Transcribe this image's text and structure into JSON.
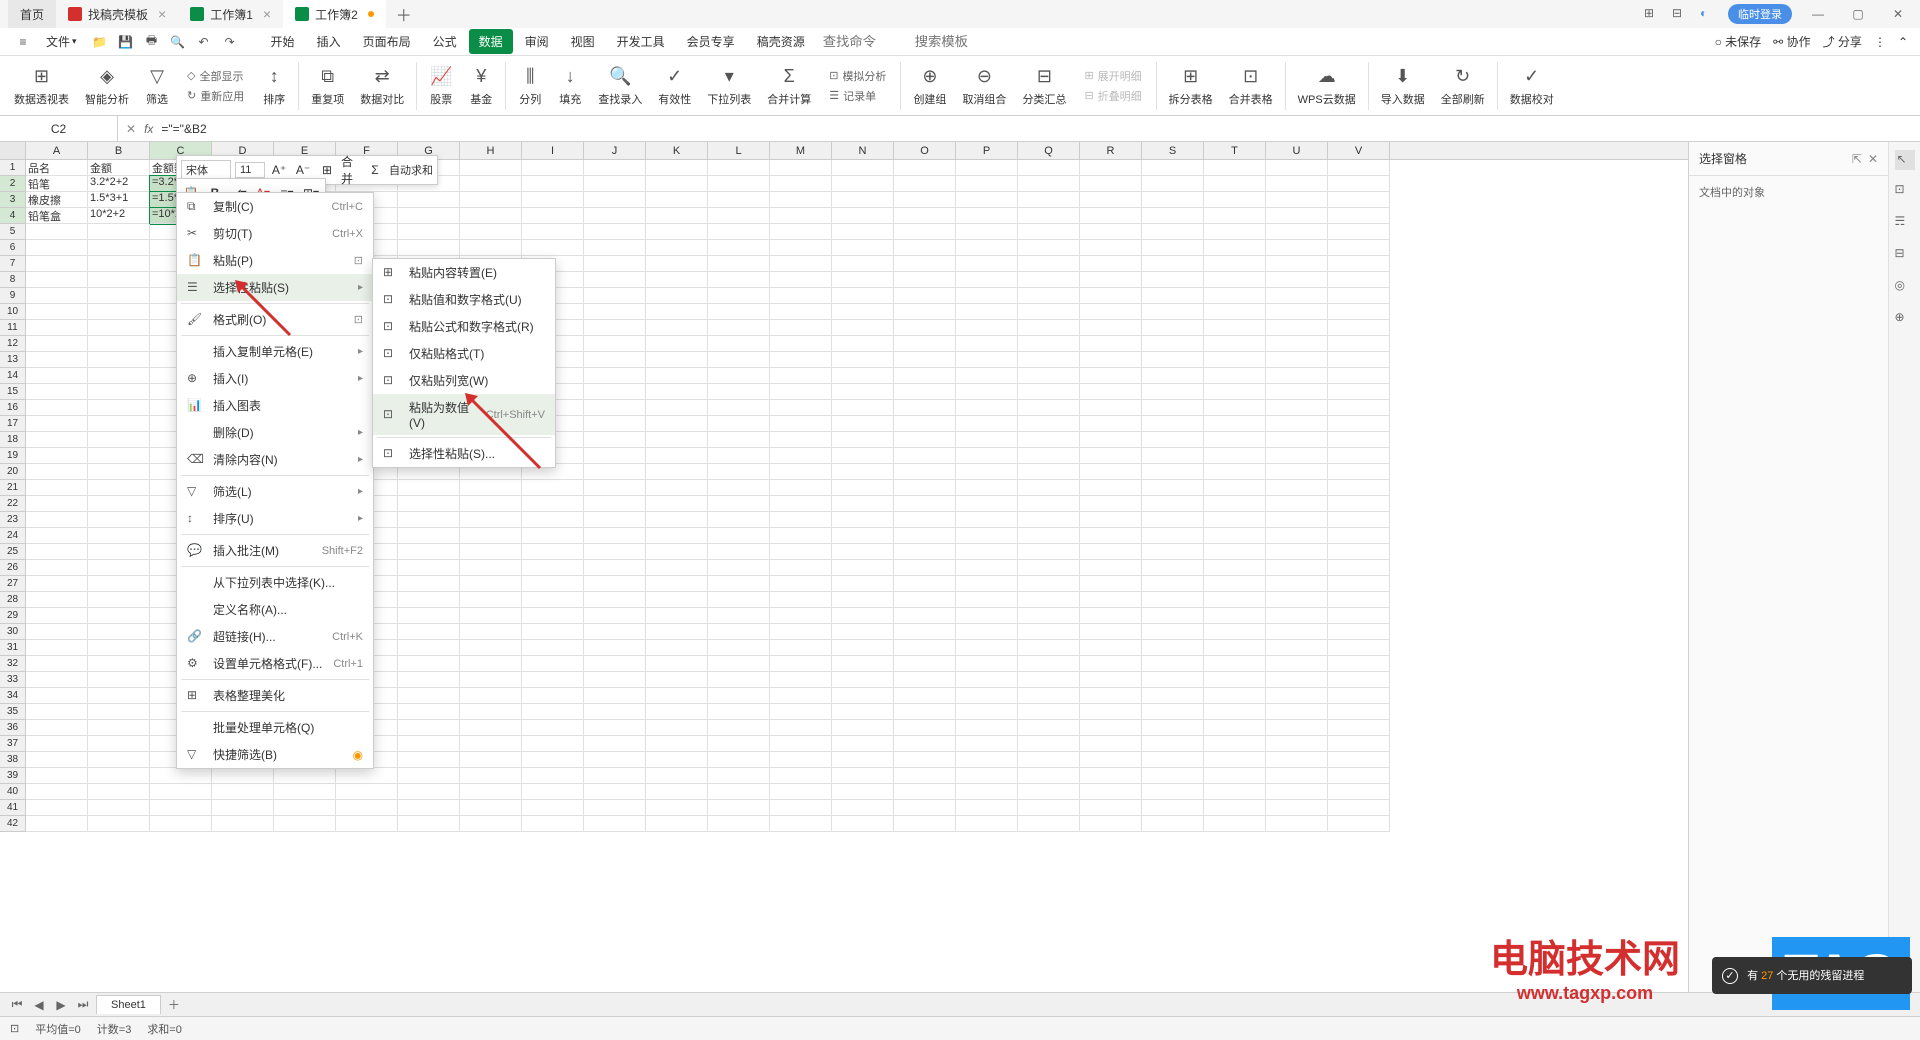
{
  "tabs": {
    "home": "首页",
    "template": "找稿壳模板",
    "wb1": "工作簿1",
    "wb2": "工作簿2"
  },
  "title_right": {
    "login": "临时登录",
    "grid": "⊞"
  },
  "qat": {
    "file": "文件"
  },
  "menu": {
    "start": "开始",
    "insert": "插入",
    "layout": "页面布局",
    "formula": "公式",
    "data": "数据",
    "review": "审阅",
    "view": "视图",
    "dev": "开发工具",
    "member": "会员专享",
    "resource": "稿壳资源",
    "search_cmd": "查找命令",
    "search_tmpl": "搜索模板"
  },
  "menu_right": {
    "unsaved": "未保存",
    "coop": "协作",
    "share": "分享"
  },
  "ribbon": {
    "pivot": "数据透视表",
    "smart": "智能分析",
    "filter": "筛选",
    "showall": "全部显示",
    "reapply": "重新应用",
    "sort": "排序",
    "dup": "重复项",
    "compare": "数据对比",
    "stock": "股票",
    "fund": "基金",
    "split": "分列",
    "fill": "填充",
    "lookup": "查找录入",
    "validity": "有效性",
    "dropdown": "下拉列表",
    "consolidate": "合并计算",
    "simulate": "模拟分析",
    "record": "记录单",
    "group": "创建组",
    "ungroup": "取消组合",
    "subtotal": "分类汇总",
    "expand": "展开明细",
    "collapse": "折叠明细",
    "splittable": "拆分表格",
    "mergetable": "合并表格",
    "wpscloud": "WPS云数据",
    "import": "导入数据",
    "refresh": "全部刷新",
    "validate": "数据校对"
  },
  "formula_bar": {
    "cell": "C2",
    "fx": "fx",
    "value": "=\"=\"&B2"
  },
  "columns": [
    "A",
    "B",
    "C",
    "D",
    "E",
    "F",
    "G",
    "H",
    "I",
    "J",
    "K",
    "L",
    "M",
    "N",
    "O",
    "P",
    "Q",
    "R",
    "S",
    "T",
    "U",
    "V"
  ],
  "table_data": {
    "headers": {
      "a": "品名",
      "b": "金额",
      "c": "金额数"
    },
    "row2": {
      "a": "铅笔",
      "b": "3.2*2+2",
      "c": "=3.2*2+2"
    },
    "row3": {
      "a": "橡皮擦",
      "b": "1.5*3+1",
      "c": "=1.5*3+1"
    },
    "row4": {
      "a": "铅笔盒",
      "b": "10*2+2",
      "c": "=10*2+2"
    }
  },
  "mini_toolbar": {
    "font": "宋体",
    "size": "11",
    "merge": "合并",
    "autosum": "自动求和"
  },
  "context_menu": {
    "copy": "复制(C)",
    "copy_sc": "Ctrl+C",
    "cut": "剪切(T)",
    "cut_sc": "Ctrl+X",
    "paste": "粘贴(P)",
    "paste_special": "选择性粘贴(S)",
    "format_painter": "格式刷(O)",
    "insert_copied": "插入复制单元格(E)",
    "insert": "插入(I)",
    "insert_chart": "插入图表",
    "delete": "删除(D)",
    "clear": "清除内容(N)",
    "filter": "筛选(L)",
    "sort": "排序(U)",
    "comment": "插入批注(M)",
    "comment_sc": "Shift+F2",
    "dropdown_select": "从下拉列表中选择(K)...",
    "define_name": "定义名称(A)...",
    "hyperlink": "超链接(H)...",
    "hyperlink_sc": "Ctrl+K",
    "format_cells": "设置单元格格式(F)...",
    "format_cells_sc": "Ctrl+1",
    "beautify": "表格整理美化",
    "batch": "批量处理单元格(Q)",
    "quick_filter": "快捷筛选(B)"
  },
  "submenu": {
    "paste_transpose": "粘贴内容转置(E)",
    "paste_values_fmt": "粘贴值和数字格式(U)",
    "paste_formula_fmt": "粘贴公式和数字格式(R)",
    "paste_fmt_only": "仅粘贴格式(T)",
    "paste_colwidth": "仅粘贴列宽(W)",
    "paste_as_value": "粘贴为数值(V)",
    "paste_as_value_sc": "Ctrl+Shift+V",
    "paste_special": "选择性粘贴(S)..."
  },
  "panel": {
    "title": "选择窗格",
    "body": "文档中的对象"
  },
  "status": {
    "avg": "平均值=0",
    "count": "计数=3",
    "sum": "求和=0"
  },
  "sheets": {
    "sheet1": "Sheet1"
  },
  "notification": {
    "prefix": "有 ",
    "num": "27",
    "suffix": " 个无用的残留进程"
  },
  "watermark": {
    "title": "电脑技术网",
    "url": "www.tagxp.com",
    "tag": "TAG"
  }
}
